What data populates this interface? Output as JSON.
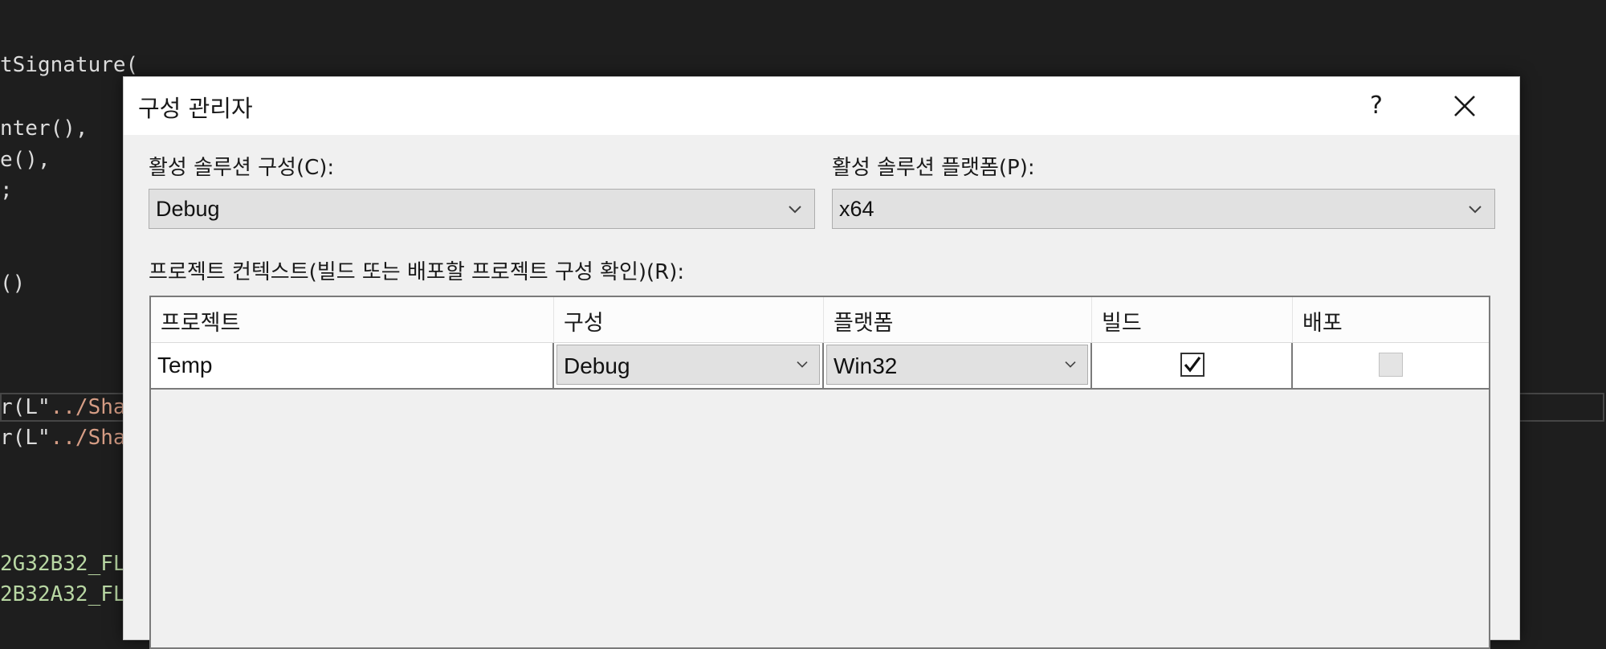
{
  "editor": {
    "lines": [
      {
        "text": "tSignature("
      },
      {
        "text": "nter(),"
      },
      {
        "text": "e(),"
      },
      {
        "text": ";"
      },
      {
        "text": "()"
      },
      {
        "prefix": "r(L\"",
        "str": "../Sha"
      },
      {
        "prefix": "r(L\"",
        "str": "../Sha"
      },
      {
        "text": "2G32B32_FL"
      },
      {
        "text": "2B32A32_FL"
      }
    ]
  },
  "dialog": {
    "title": "구성 관리자",
    "help_label": "?",
    "close_icon": "close-icon",
    "active_config": {
      "label": "활성 솔루션 구성(C):",
      "value": "Debug"
    },
    "active_platform": {
      "label": "활성 솔루션 플랫폼(P):",
      "value": "x64"
    },
    "project_context_label": "프로젝트 컨텍스트(빌드 또는 배포할 프로젝트 구성 확인)(R):",
    "table": {
      "columns": [
        "프로젝트",
        "구성",
        "플랫폼",
        "빌드",
        "배포"
      ],
      "rows": [
        {
          "project": "Temp",
          "configuration": "Debug",
          "platform": "Win32",
          "build": true,
          "deploy": false
        }
      ]
    }
  },
  "colors": {
    "editor_bg": "#1e1e1e",
    "dialog_bg": "#f0f0f0",
    "titlebar_bg": "#ffffff",
    "combo_bg": "#e1e1e1"
  }
}
